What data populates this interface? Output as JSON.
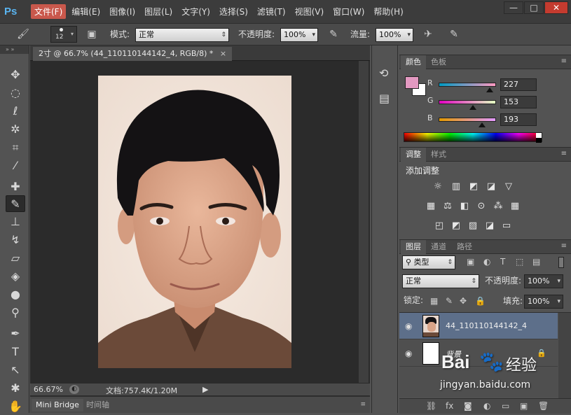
{
  "app": {
    "logo": "Ps"
  },
  "menu": [
    "文件(F)",
    "编辑(E)",
    "图像(I)",
    "图层(L)",
    "文字(Y)",
    "选择(S)",
    "滤镜(T)",
    "视图(V)",
    "窗口(W)",
    "帮助(H)"
  ],
  "window_controls": {
    "minimize": "—",
    "maximize": "□",
    "close": "✕"
  },
  "options": {
    "brush_size": "12",
    "mode_label": "模式:",
    "mode_value": "正常",
    "opacity_label": "不透明度:",
    "opacity_value": "100%",
    "flow_label": "流量:",
    "flow_value": "100%"
  },
  "document": {
    "tab_title": "2寸 @ 66.7% (44_110110144142_4, RGB/8) *",
    "tab_close": "×",
    "zoom": "66.67%",
    "doc_size": "文档:757.4K/1.20M"
  },
  "bottom_tabs": [
    "Mini Bridge",
    "时间轴"
  ],
  "color_panel": {
    "tabs": [
      "颜色",
      "色板"
    ],
    "foreground": "#e399c1",
    "channels": [
      {
        "name": "R",
        "value": "227",
        "fraction": 0.89
      },
      {
        "name": "G",
        "value": "153",
        "fraction": 0.6
      },
      {
        "name": "B",
        "value": "193",
        "fraction": 0.757
      }
    ]
  },
  "adjust_panel": {
    "tabs": [
      "调整",
      "样式"
    ],
    "title": "添加调整"
  },
  "layers_panel": {
    "tabs": [
      "图层",
      "通道",
      "路径"
    ],
    "filter": "类型",
    "blend_mode": "正常",
    "opacity_label": "不透明度:",
    "opacity_value": "100%",
    "lock_label": "锁定:",
    "fill_label": "填充:",
    "fill_value": "100%",
    "layers": [
      {
        "name": "44_110110144142_4",
        "selected": true
      },
      {
        "name": "背景",
        "locked": true
      }
    ]
  },
  "watermark": {
    "site": "jingyan.baidu.com",
    "brand": "Bai",
    "brand2": "经验"
  }
}
